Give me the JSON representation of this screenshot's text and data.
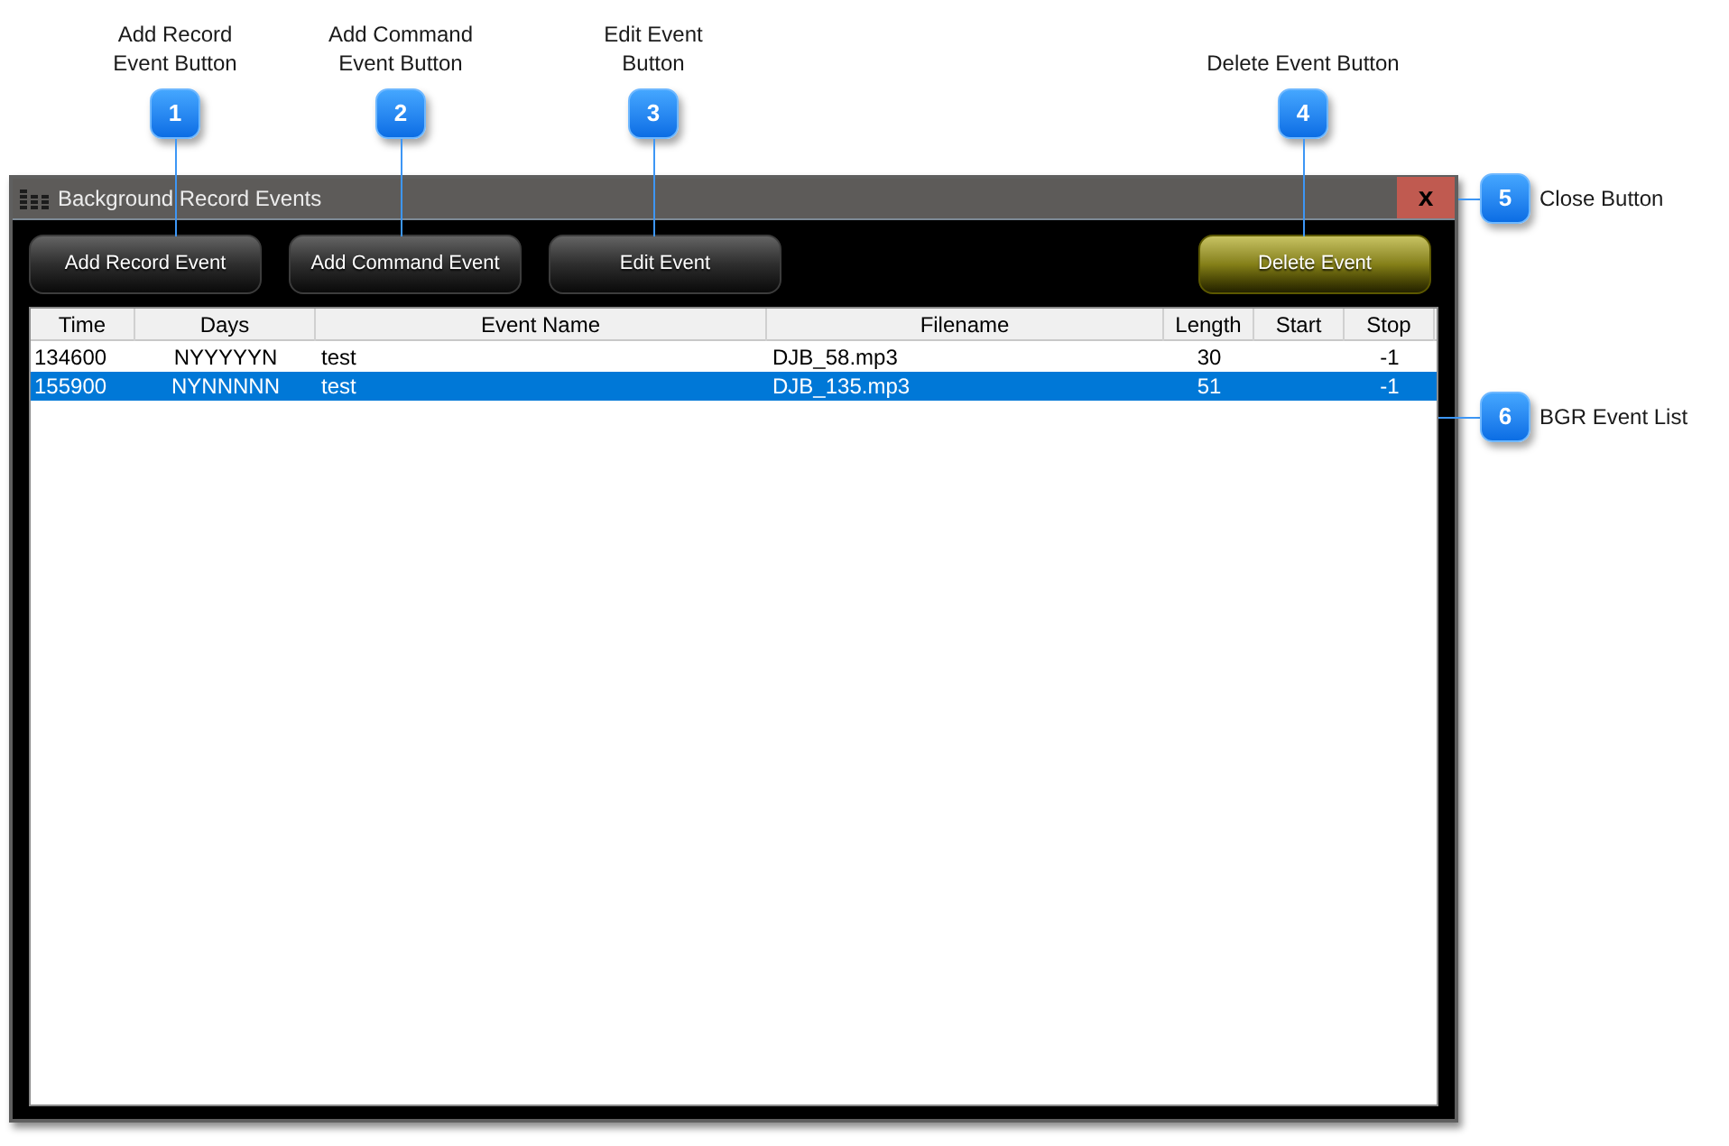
{
  "callouts": [
    {
      "kind": "top",
      "number": "1",
      "label": "Add Record\nEvent Button"
    },
    {
      "kind": "top",
      "number": "2",
      "label": "Add Command\nEvent Button"
    },
    {
      "kind": "top",
      "number": "3",
      "label": "Edit Event\nButton"
    },
    {
      "kind": "top",
      "number": "4",
      "label": "Delete Event Button"
    },
    {
      "kind": "side",
      "number": "5",
      "label": "Close Button"
    },
    {
      "kind": "side",
      "number": "6",
      "label": "BGR Event List"
    }
  ],
  "window": {
    "title": "Background Record Events",
    "close_button": "x"
  },
  "toolbar": {
    "buttons": [
      {
        "kind": "default",
        "label": "Add Record Event"
      },
      {
        "kind": "default",
        "label": "Add Command Event"
      },
      {
        "kind": "default",
        "label": "Edit Event"
      },
      {
        "kind": "delete",
        "label": "Delete Event"
      }
    ]
  },
  "table": {
    "columns": [
      "Time",
      "Days",
      "Event Name",
      "Filename",
      "Length",
      "Start",
      "Stop"
    ],
    "rows": [
      {
        "selected": false,
        "cells": [
          "134600",
          "NYYYYYN",
          "test",
          "DJB_58.mp3",
          "30",
          null,
          "-1"
        ]
      },
      {
        "selected": true,
        "cells": [
          "155900",
          "NYNNNNN",
          "test",
          "DJB_135.mp3",
          "51",
          null,
          "-1"
        ]
      }
    ]
  }
}
